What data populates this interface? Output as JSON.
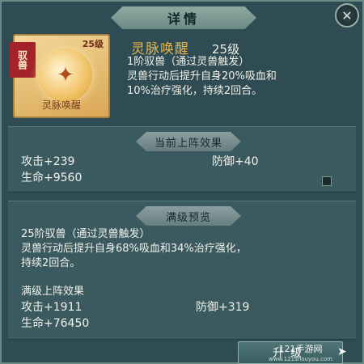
{
  "header": {
    "title": "详情",
    "close_icon": "close-icon"
  },
  "skill": {
    "card_tag": "驭兽",
    "card_level": "25级",
    "card_name": "灵脉唤醒",
    "name": "灵脉唤醒",
    "level": "25级",
    "desc_line1": "1阶驭兽（通过灵兽触发）",
    "desc_line2": "灵兽行动后提升自身20%吸血和",
    "desc_line3": "10%治疗强化，持续2回合。"
  },
  "current": {
    "banner": "当前上阵效果",
    "attack": "攻击+239",
    "defense": "防御+40",
    "hp": "生命+9560"
  },
  "max": {
    "banner": "满级预览",
    "desc_line1": "25阶驭兽（通过灵兽触发）",
    "desc_line2": "灵兽行动后提升自身68%吸血和34%治疗强化，",
    "desc_line3": "持续2回合。",
    "effects_title": "满级上阵效果",
    "attack": "攻击+1911",
    "defense": "防御+319",
    "hp": "生命+76450"
  },
  "buttons": {
    "upgrade": "升级"
  },
  "watermark": {
    "line1": "121手游网",
    "line2": "www.121shouyou.com"
  },
  "colors": {
    "panel": "#2f4b53",
    "skill_name": "#e9b441",
    "text": "#f2f2ea"
  }
}
